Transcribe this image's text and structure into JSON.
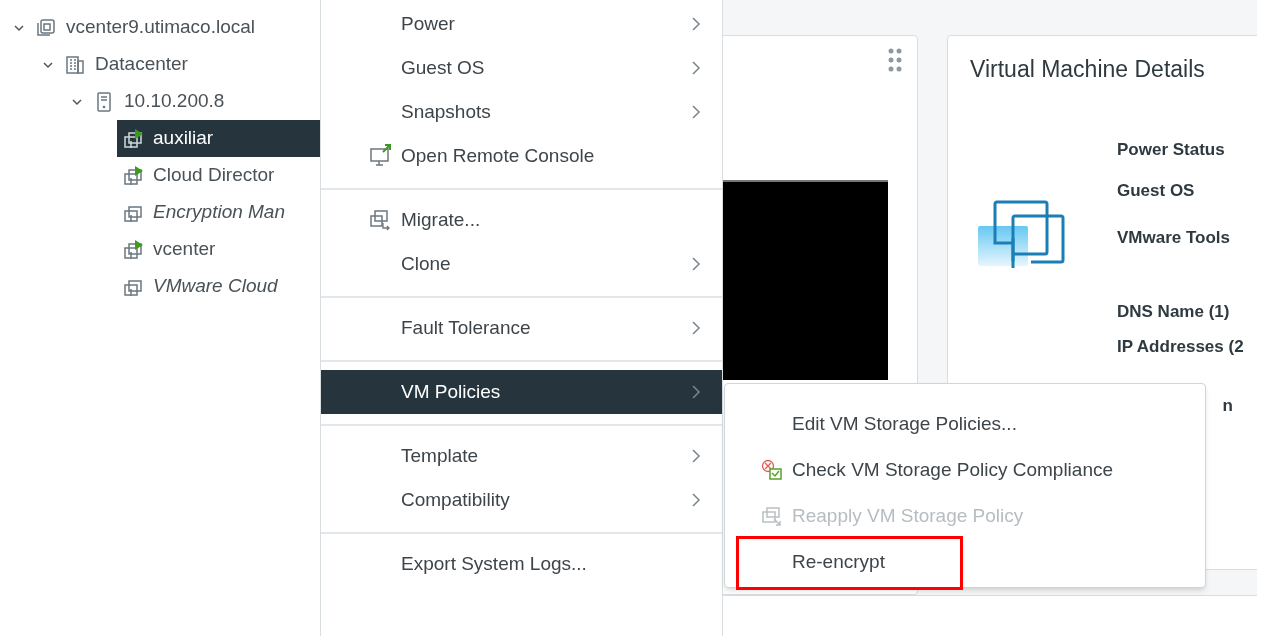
{
  "tree": [
    {
      "label": "vcenter9.utimaco.local",
      "kind": "vcenter",
      "expanded": true,
      "selected": false,
      "italic": false,
      "children": [
        {
          "label": "Datacenter",
          "kind": "datacenter",
          "expanded": true,
          "selected": false,
          "italic": false,
          "children": [
            {
              "label": "10.10.200.8",
              "kind": "host",
              "expanded": true,
              "selected": false,
              "italic": false,
              "children": [
                {
                  "label": "auxiliar",
                  "kind": "vm",
                  "powered_on": true,
                  "selected": true,
                  "italic": false
                },
                {
                  "label": "Cloud Director",
                  "kind": "vm",
                  "powered_on": true,
                  "selected": false,
                  "italic": false
                },
                {
                  "label": "Encryption Man",
                  "kind": "vm",
                  "powered_on": false,
                  "selected": false,
                  "italic": true
                },
                {
                  "label": "vcenter",
                  "kind": "vm",
                  "powered_on": true,
                  "selected": false,
                  "italic": false
                },
                {
                  "label": "VMware Cloud",
                  "kind": "vm",
                  "powered_on": false,
                  "selected": false,
                  "italic": true
                }
              ]
            }
          ]
        }
      ]
    }
  ],
  "details_card": {
    "title": "Virtual Machine Details",
    "labels": [
      "Power Status",
      "Guest OS",
      "VMware Tools",
      "DNS Name (1)",
      "IP Addresses (2",
      "n"
    ]
  },
  "context_menu": {
    "groups": [
      [
        {
          "label": "Power",
          "submenu": true,
          "selected": false,
          "kind": "plain"
        },
        {
          "label": "Guest OS",
          "submenu": true,
          "selected": false,
          "kind": "plain"
        },
        {
          "label": "Snapshots",
          "submenu": true,
          "selected": false,
          "kind": "plain"
        },
        {
          "label": "Open Remote Console",
          "submenu": false,
          "selected": false,
          "kind": "console"
        }
      ],
      [
        {
          "label": "Migrate...",
          "submenu": false,
          "selected": false,
          "kind": "migrate"
        },
        {
          "label": "Clone",
          "submenu": true,
          "selected": false,
          "kind": "plain"
        }
      ],
      [
        {
          "label": "Fault Tolerance",
          "submenu": true,
          "selected": false,
          "kind": "plain"
        }
      ],
      [
        {
          "label": "VM Policies",
          "submenu": true,
          "selected": true,
          "kind": "plain"
        }
      ],
      [
        {
          "label": "Template",
          "submenu": true,
          "selected": false,
          "kind": "plain"
        },
        {
          "label": "Compatibility",
          "submenu": true,
          "selected": false,
          "kind": "plain"
        }
      ],
      [
        {
          "label": "Export System Logs...",
          "submenu": false,
          "selected": false,
          "kind": "plain"
        }
      ]
    ]
  },
  "submenu": {
    "items": [
      {
        "label": "Edit VM Storage Policies...",
        "kind": "plain",
        "disabled": false,
        "highlighted": false
      },
      {
        "label": "Check VM Storage Policy Compliance",
        "kind": "check",
        "disabled": false,
        "highlighted": false
      },
      {
        "label": "Reapply VM Storage Policy",
        "kind": "reapply",
        "disabled": true,
        "highlighted": false
      },
      {
        "label": "Re-encrypt",
        "kind": "plain",
        "disabled": false,
        "highlighted": true
      }
    ]
  }
}
